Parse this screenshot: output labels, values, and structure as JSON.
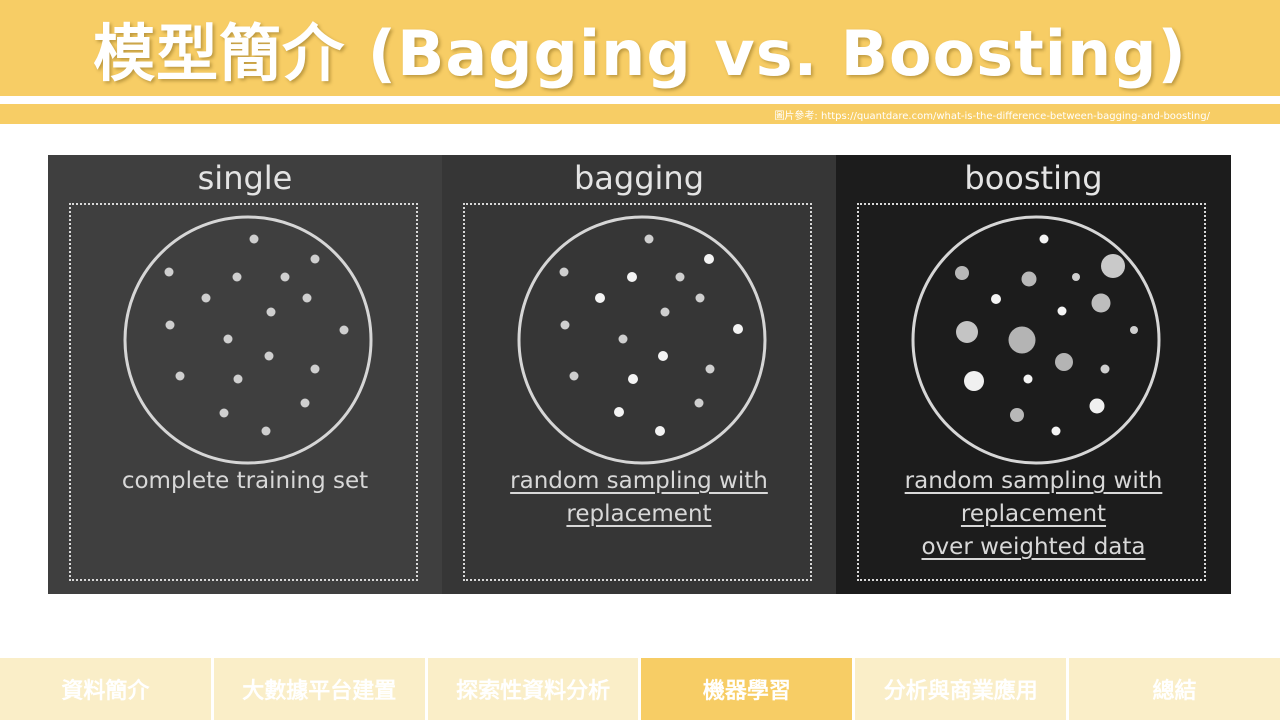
{
  "title": "模型簡介 (Bagging vs. Boosting)",
  "source_ref": "圖片參考: https://quantdare.com/what-is-the-difference-between-bagging-and-boosting/",
  "colors": {
    "accent": "#f7cd65",
    "nav_inactive": "#faeec8"
  },
  "panels": [
    {
      "title": "single",
      "caption_lines": [
        "complete training set"
      ],
      "underlined": false
    },
    {
      "title": "bagging",
      "caption_lines": [
        "random sampling with",
        "replacement"
      ],
      "underlined": true
    },
    {
      "title": "boosting",
      "caption_lines": [
        "random sampling with",
        "replacement",
        "over weighted data"
      ],
      "underlined": true
    }
  ],
  "nav": [
    {
      "label": "資料簡介",
      "active": false
    },
    {
      "label": "大數據平台建置",
      "active": false
    },
    {
      "label": "探索性資料分析",
      "active": false
    },
    {
      "label": "機器學習",
      "active": true
    },
    {
      "label": "分析與商業應用",
      "active": false
    },
    {
      "label": "總結",
      "active": false
    }
  ]
}
